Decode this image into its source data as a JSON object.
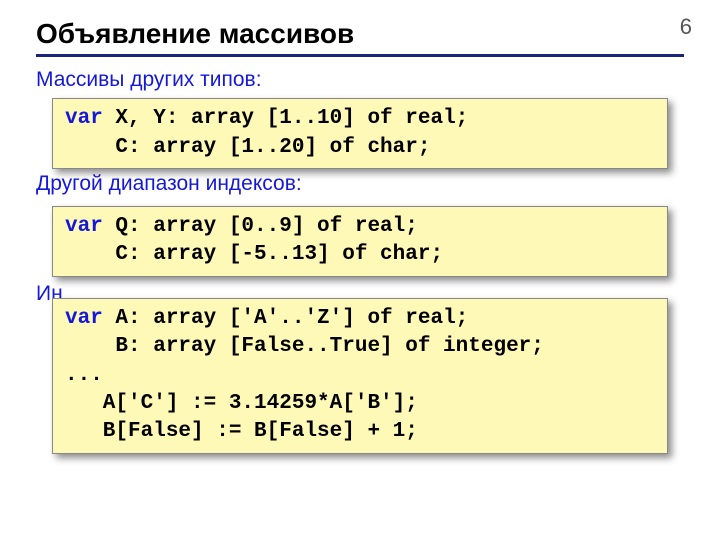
{
  "page_number": "6",
  "title": "Объявление массивов",
  "sections": {
    "s1": "Массивы других типов:",
    "s2": "Другой диапазон индексов:",
    "s3": "Ин"
  },
  "code1": {
    "kw": "var",
    "body": " X, Y: array [1..10] of real;\n    C: array [1..20] of char;"
  },
  "code2": {
    "kw": "var",
    "body": " Q: array [0..9] of real;\n    C: array [-5..13] of char;"
  },
  "code3": {
    "kw": "var",
    "body": " A: array ['A'..'Z'] of real;\n    B: array [False..True] of integer;\n...\n   A['C'] := 3.14259*A['B'];\n   B[False] := B[False] + 1;"
  }
}
